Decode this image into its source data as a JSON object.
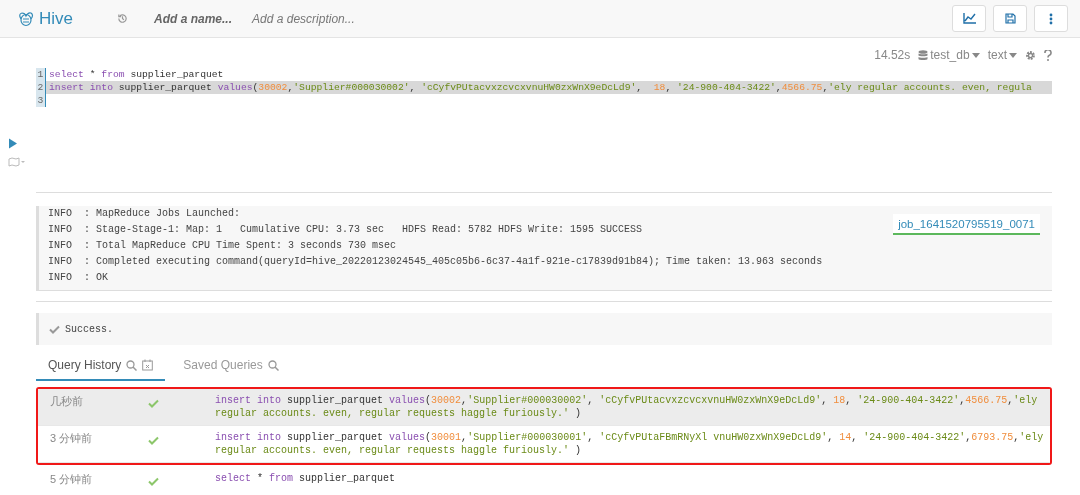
{
  "header": {
    "app_name": "Hive",
    "name_placeholder": "Add a name...",
    "description_placeholder": "Add a description..."
  },
  "editor": {
    "duration": "14.52s",
    "database": "test_db",
    "format": "text",
    "lines": [
      {
        "number": "1",
        "active": false,
        "tokens": [
          {
            "kind": "keyword",
            "text": "select"
          },
          {
            "kind": "plain",
            "text": " * "
          },
          {
            "kind": "keyword",
            "text": "from"
          },
          {
            "kind": "plain",
            "text": " supplier_parquet"
          }
        ]
      },
      {
        "number": "2",
        "active": true,
        "tokens": [
          {
            "kind": "keyword",
            "text": "insert "
          },
          {
            "kind": "keyword",
            "text": "into"
          },
          {
            "kind": "plain",
            "text": " supplier_parquet "
          },
          {
            "kind": "keyword",
            "text": "values"
          },
          {
            "kind": "plain",
            "text": "("
          },
          {
            "kind": "number",
            "text": "30002"
          },
          {
            "kind": "plain",
            "text": ","
          },
          {
            "kind": "string",
            "text": "'Supplier#000030002'"
          },
          {
            "kind": "plain",
            "text": ", "
          },
          {
            "kind": "string",
            "text": "'cCyfvPUtacvxzcvcxvnuHW0zxWnX9eDcLd9'"
          },
          {
            "kind": "plain",
            "text": ",  "
          },
          {
            "kind": "number",
            "text": "18"
          },
          {
            "kind": "plain",
            "text": ", "
          },
          {
            "kind": "string",
            "text": "'24-900-404-3422'"
          },
          {
            "kind": "plain",
            "text": ","
          },
          {
            "kind": "number",
            "text": "4566.75"
          },
          {
            "kind": "plain",
            "text": ","
          },
          {
            "kind": "string",
            "text": "'ely regular accounts. even, regula"
          }
        ]
      },
      {
        "number": "3",
        "active": false
      }
    ]
  },
  "log": {
    "lines": [
      "INFO  : MapReduce Jobs Launched:",
      "INFO  : Stage-Stage-1: Map: 1   Cumulative CPU: 3.73 sec   HDFS Read: 5782 HDFS Write: 1595 SUCCESS",
      "INFO  : Total MapReduce CPU Time Spent: 3 seconds 730 msec",
      "INFO  : Completed executing command(queryId=hive_20220123024545_405c05b6-6c37-4a1f-921e-c17839d91b84); Time taken: 13.963 seconds",
      "INFO  : OK"
    ],
    "job_link": "job_1641520795519_0071"
  },
  "result": {
    "message": "Success."
  },
  "tabs": [
    {
      "label": "Query History",
      "selected": true
    },
    {
      "label": "Saved Queries",
      "selected": false
    }
  ],
  "history": [
    {
      "time": "几秒前",
      "succeeded": true,
      "selected": true,
      "highlighted": true,
      "tokens": [
        {
          "kind": "keyword",
          "text": "insert "
        },
        {
          "kind": "keyword",
          "text": "into"
        },
        {
          "kind": "plain",
          "text": " supplier_parquet "
        },
        {
          "kind": "keyword",
          "text": "values"
        },
        {
          "kind": "plain",
          "text": "("
        },
        {
          "kind": "number",
          "text": "30002"
        },
        {
          "kind": "plain",
          "text": ","
        },
        {
          "kind": "string",
          "text": "'Supplier#000030002'"
        },
        {
          "kind": "plain",
          "text": ", "
        },
        {
          "kind": "string",
          "text": "'cCyfvPUtacvxzcvcxvnuHW0zxWnX9eDcLd9'"
        },
        {
          "kind": "plain",
          "text": ", "
        },
        {
          "kind": "number",
          "text": "18"
        },
        {
          "kind": "plain",
          "text": ", "
        },
        {
          "kind": "string",
          "text": "'24-900-404-3422'"
        },
        {
          "kind": "plain",
          "text": ","
        },
        {
          "kind": "number",
          "text": "4566.75"
        },
        {
          "kind": "plain",
          "text": ","
        },
        {
          "kind": "string",
          "text": "'ely regular accounts. even, regular requests haggle furiously.'"
        },
        {
          "kind": "plain",
          "text": " )"
        }
      ]
    },
    {
      "time": "3 分钟前",
      "succeeded": true,
      "selected": false,
      "highlighted": true,
      "tokens": [
        {
          "kind": "keyword",
          "text": "insert "
        },
        {
          "kind": "keyword",
          "text": "into"
        },
        {
          "kind": "plain",
          "text": " supplier_parquet "
        },
        {
          "kind": "keyword",
          "text": "values"
        },
        {
          "kind": "plain",
          "text": "("
        },
        {
          "kind": "number",
          "text": "30001"
        },
        {
          "kind": "plain",
          "text": ","
        },
        {
          "kind": "string",
          "text": "'Supplier#000030001'"
        },
        {
          "kind": "plain",
          "text": ", "
        },
        {
          "kind": "string",
          "text": "'cCyfvPUtaFBmRNyXl vnuHW0zxWnX9eDcLd9'"
        },
        {
          "kind": "plain",
          "text": ", "
        },
        {
          "kind": "number",
          "text": "14"
        },
        {
          "kind": "plain",
          "text": ", "
        },
        {
          "kind": "string",
          "text": "'24-900-404-3422'"
        },
        {
          "kind": "plain",
          "text": ","
        },
        {
          "kind": "number",
          "text": "6793.75"
        },
        {
          "kind": "plain",
          "text": ","
        },
        {
          "kind": "string",
          "text": "'ely regular accounts. even, regular requests haggle furiously.'"
        },
        {
          "kind": "plain",
          "text": " )"
        }
      ]
    },
    {
      "time": "5 分钟前",
      "succeeded": true,
      "selected": false,
      "highlighted": false,
      "tokens": [
        {
          "kind": "keyword",
          "text": "select"
        },
        {
          "kind": "plain",
          "text": " * "
        },
        {
          "kind": "keyword",
          "text": "from"
        },
        {
          "kind": "plain",
          "text": " supplier_parquet"
        }
      ]
    }
  ]
}
